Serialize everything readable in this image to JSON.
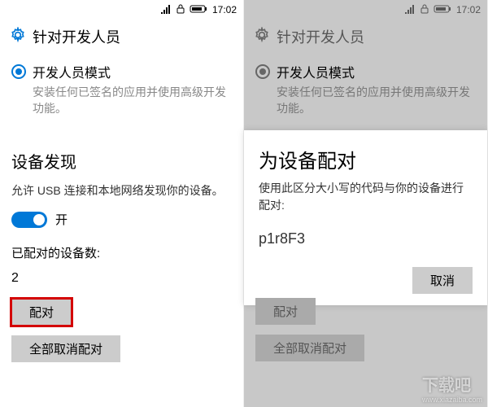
{
  "status": {
    "time": "17:02"
  },
  "header": {
    "title": "针对开发人员"
  },
  "devmode": {
    "label": "开发人员模式",
    "desc": "安装任何已签名的应用并使用高级开发功能。"
  },
  "discovery": {
    "title": "设备发现",
    "desc": "允许 USB 连接和本地网络发现你的设备。",
    "toggle_state": "开",
    "paired_label": "已配对的设备数:",
    "paired_count": "2",
    "pair_btn": "配对",
    "unpair_all_btn": "全部取消配对"
  },
  "dialog": {
    "title": "为设备配对",
    "text": "使用此区分大小写的代码与你的设备进行配对:",
    "code": "p1r8F3",
    "cancel": "取消"
  },
  "watermark": {
    "main": "下载吧",
    "sub": "www.xiazaiba.com"
  }
}
